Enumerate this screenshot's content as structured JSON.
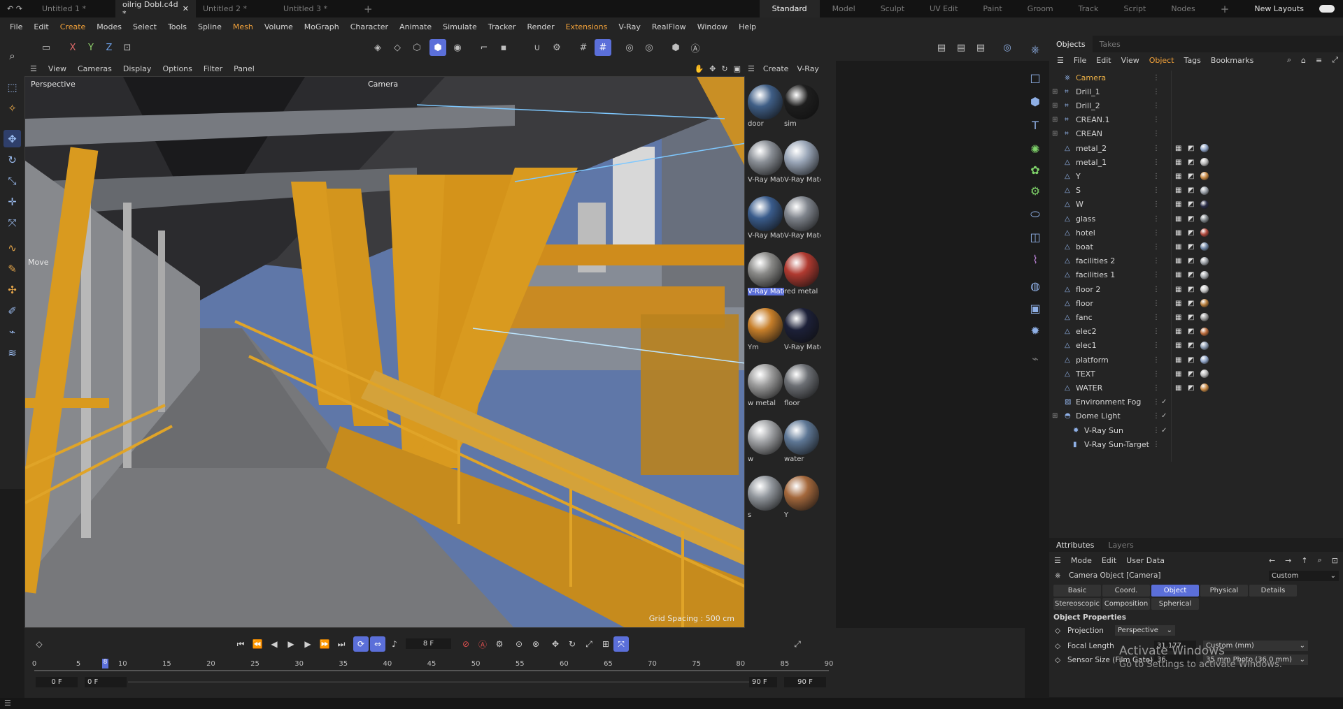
{
  "file_tabs": [
    {
      "label": "Untitled 1 *",
      "active": false
    },
    {
      "label": "oilrig Dobl.c4d *",
      "active": true
    },
    {
      "label": "Untitled 2 *",
      "active": false
    },
    {
      "label": "Untitled 3 *",
      "active": false
    }
  ],
  "layouts": [
    "Standard",
    "Model",
    "Sculpt",
    "UV Edit",
    "Paint",
    "Groom",
    "Track",
    "Script",
    "Nodes"
  ],
  "new_layouts": "New Layouts",
  "menu": [
    "File",
    "Edit",
    "Create",
    "Modes",
    "Select",
    "Tools",
    "Spline",
    "Mesh",
    "Volume",
    "MoGraph",
    "Character",
    "Animate",
    "Simulate",
    "Tracker",
    "Render",
    "Extensions",
    "V-Ray",
    "RealFlow",
    "Window",
    "Help"
  ],
  "axes": {
    "x": "X",
    "y": "Y",
    "z": "Z"
  },
  "viewport_menu": [
    "View",
    "Cameras",
    "Display",
    "Options",
    "Filter",
    "Panel"
  ],
  "viewport": {
    "name": "Perspective",
    "camera": "Camera",
    "move": "Move",
    "grid": "Grid Spacing : 500 cm"
  },
  "material_menu": [
    "Create",
    "V-Ray"
  ],
  "materials": [
    {
      "name": "door",
      "color": "#3f5e86"
    },
    {
      "name": "sim",
      "color": "#1e1e1e"
    },
    {
      "name": "V-Ray Mate",
      "color": "#8a8f96"
    },
    {
      "name": "V-Ray Mate",
      "color": "#9aa6b8"
    },
    {
      "name": "V-Ray Mate",
      "color": "#3a5c8c"
    },
    {
      "name": "V-Ray Mate",
      "color": "#7f848c"
    },
    {
      "name": "V-Ray Mate",
      "color": "#8a8a88"
    },
    {
      "name": "red metal",
      "color": "#b03a30"
    },
    {
      "name": "Ym",
      "color": "#c77f2a"
    },
    {
      "name": "V-Ray Mate",
      "color": "#1c2038"
    },
    {
      "name": "w metal",
      "color": "#9c9c9c"
    },
    {
      "name": "floor",
      "color": "#6c6f74"
    },
    {
      "name": "w",
      "color": "#a2a4a7"
    },
    {
      "name": "water",
      "color": "#5e7795"
    },
    {
      "name": "s",
      "color": "#92979d"
    },
    {
      "name": "Y",
      "color": "#a4683c"
    }
  ],
  "objects_tabs": [
    "Objects",
    "Takes"
  ],
  "objects_menu": [
    "File",
    "Edit",
    "View",
    "Object",
    "Tags",
    "Bookmarks"
  ],
  "objects": [
    {
      "name": "Camera",
      "type": "camera"
    },
    {
      "name": "Drill_1",
      "type": "null"
    },
    {
      "name": "Drill_2",
      "type": "null"
    },
    {
      "name": "CREAN.1",
      "type": "null"
    },
    {
      "name": "CREAN",
      "type": "null"
    },
    {
      "name": "metal_2",
      "type": "mesh"
    },
    {
      "name": "metal_1",
      "type": "mesh"
    },
    {
      "name": "Y",
      "type": "mesh"
    },
    {
      "name": "S",
      "type": "mesh"
    },
    {
      "name": "W",
      "type": "mesh"
    },
    {
      "name": "glass",
      "type": "mesh"
    },
    {
      "name": "hotel",
      "type": "mesh"
    },
    {
      "name": "boat",
      "type": "mesh"
    },
    {
      "name": "facilities 2",
      "type": "mesh"
    },
    {
      "name": "facilities 1",
      "type": "mesh"
    },
    {
      "name": "floor 2",
      "type": "mesh"
    },
    {
      "name": "floor",
      "type": "mesh"
    },
    {
      "name": "fanc",
      "type": "mesh"
    },
    {
      "name": "elec2",
      "type": "mesh"
    },
    {
      "name": "elec1",
      "type": "mesh"
    },
    {
      "name": "platform",
      "type": "mesh"
    },
    {
      "name": "TEXT",
      "type": "mesh"
    },
    {
      "name": "WATER",
      "type": "mesh"
    },
    {
      "name": "Environment Fog",
      "type": "fog"
    },
    {
      "name": "Dome Light",
      "type": "light"
    },
    {
      "name": "V-Ray Sun",
      "type": "sun"
    },
    {
      "name": "V-Ray Sun-Target",
      "type": "target"
    }
  ],
  "attributes": {
    "tabs": [
      "Attributes",
      "Layers"
    ],
    "menu": [
      "Mode",
      "Edit",
      "User Data"
    ],
    "title": "Camera Object [Camera]",
    "preset": "Custom",
    "buttons_row1": [
      "Basic",
      "Coord.",
      "Object",
      "Physical",
      "Details"
    ],
    "buttons_row2": [
      "Stereoscopic",
      "Composition",
      "Spherical"
    ],
    "section": "Object Properties",
    "projection_label": "Projection",
    "projection_value": "Perspective",
    "focal_label": "Focal Length",
    "focal_value": "31.177",
    "focal_preset": "Custom (mm)",
    "sensor_label": "Sensor Size (Film Gate)",
    "sensor_value": "36",
    "sensor_preset": "35 mm Photo (36.0 mm)"
  },
  "timeline": {
    "current_frame": "8 F",
    "ticks": [
      "0",
      "5",
      "10",
      "15",
      "20",
      "25",
      "30",
      "35",
      "40",
      "45",
      "50",
      "55",
      "60",
      "65",
      "70",
      "75",
      "80",
      "85",
      "90"
    ],
    "playhead": "8",
    "start": "0 F",
    "start2": "0 F",
    "end": "90 F",
    "end2": "90 F"
  },
  "watermark": {
    "title": "Activate Windows",
    "subtitle": "Go to Settings to activate Windows."
  },
  "colors": {
    "accent": "#5b6fd9",
    "highlight": "#f2a23a",
    "sky": "#5f77a8",
    "steel_yellow": "#d99a1f"
  }
}
